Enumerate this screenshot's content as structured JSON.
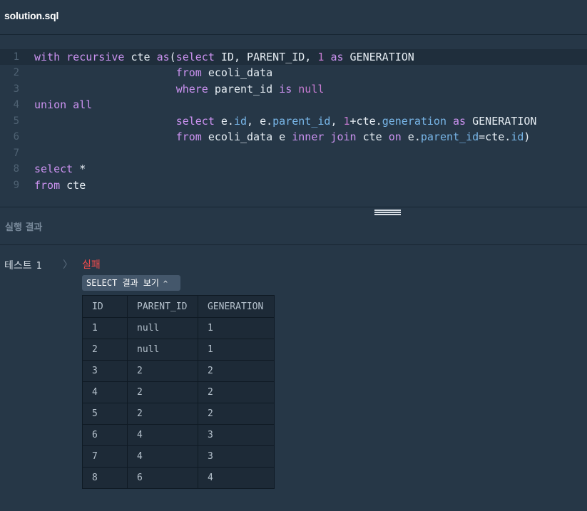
{
  "header": {
    "file_name": "solution.sql"
  },
  "editor": {
    "active_line": 1,
    "lines": [
      {
        "n": "1",
        "tokens": [
          [
            "kw",
            "with recursive "
          ],
          [
            "",
            "cte "
          ],
          [
            "kw",
            "as"
          ],
          [
            "",
            "("
          ],
          [
            "kw",
            "select "
          ],
          [
            "",
            "ID, PARENT_ID, "
          ],
          [
            "num",
            "1"
          ],
          [
            "",
            " "
          ],
          [
            "kw",
            "as"
          ],
          [
            "",
            " GENERATION"
          ]
        ]
      },
      {
        "n": "2",
        "tokens": [
          [
            "",
            "                      "
          ],
          [
            "kw",
            "from"
          ],
          [
            "",
            " ecoli_data"
          ]
        ]
      },
      {
        "n": "3",
        "tokens": [
          [
            "",
            "                      "
          ],
          [
            "kw",
            "where"
          ],
          [
            "",
            " parent_id "
          ],
          [
            "kw",
            "is"
          ],
          [
            "",
            " "
          ],
          [
            "nul",
            "null"
          ]
        ]
      },
      {
        "n": "4",
        "tokens": [
          [
            "kw",
            "union all"
          ]
        ]
      },
      {
        "n": "5",
        "tokens": [
          [
            "",
            "                      "
          ],
          [
            "kw",
            "select"
          ],
          [
            "",
            " e."
          ],
          [
            "prop",
            "id"
          ],
          [
            "",
            ", e."
          ],
          [
            "prop",
            "parent_id"
          ],
          [
            "",
            ", "
          ],
          [
            "num",
            "1"
          ],
          [
            "",
            "+cte."
          ],
          [
            "prop",
            "generation"
          ],
          [
            "",
            " "
          ],
          [
            "kw",
            "as"
          ],
          [
            "",
            " GENERATION"
          ]
        ]
      },
      {
        "n": "6",
        "tokens": [
          [
            "",
            "                      "
          ],
          [
            "kw",
            "from"
          ],
          [
            "",
            " ecoli_data e "
          ],
          [
            "kw",
            "inner join"
          ],
          [
            "",
            " cte "
          ],
          [
            "kw",
            "on"
          ],
          [
            "",
            " e."
          ],
          [
            "prop",
            "parent_id"
          ],
          [
            "",
            "=cte."
          ],
          [
            "prop",
            "id"
          ],
          [
            "",
            ")"
          ]
        ]
      },
      {
        "n": "7",
        "tokens": []
      },
      {
        "n": "8",
        "tokens": [
          [
            "kw",
            "select"
          ],
          [
            "",
            " *"
          ]
        ]
      },
      {
        "n": "9",
        "tokens": [
          [
            "kw",
            "from"
          ],
          [
            "",
            " cte"
          ]
        ]
      }
    ]
  },
  "results": {
    "title": "실행 결과",
    "test_label": "테스트",
    "test_number": "1",
    "chevron": "〉",
    "status": "실패",
    "select_button": "SELECT 결과 보기",
    "select_button_caret": "^",
    "columns": [
      "ID",
      "PARENT_ID",
      "GENERATION"
    ],
    "rows": [
      [
        "1",
        "null",
        "1"
      ],
      [
        "2",
        "null",
        "1"
      ],
      [
        "3",
        "2",
        "2"
      ],
      [
        "4",
        "2",
        "2"
      ],
      [
        "5",
        "2",
        "2"
      ],
      [
        "6",
        "4",
        "3"
      ],
      [
        "7",
        "4",
        "3"
      ],
      [
        "8",
        "6",
        "4"
      ]
    ]
  }
}
